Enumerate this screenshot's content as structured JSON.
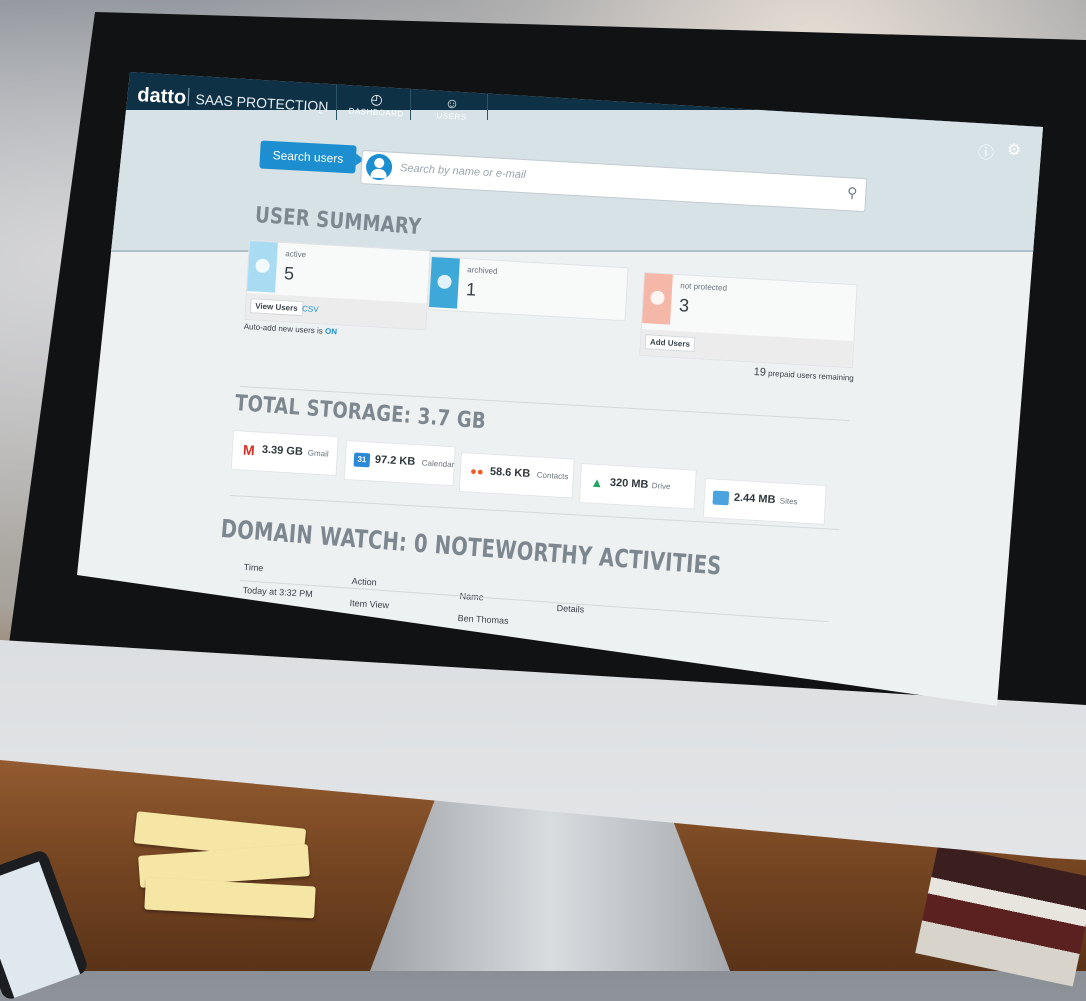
{
  "app": {
    "brand": "datto",
    "product": "SAAS PROTECTION",
    "nav": [
      {
        "label": "DASHBOARD",
        "icon": "dashboard-gauge-icon"
      },
      {
        "label": "USERS",
        "icon": "user-icon"
      }
    ],
    "top_icons": [
      "alert-icon",
      "gear-icon"
    ]
  },
  "search": {
    "button_label": "Search users",
    "placeholder": "Search by name or e-mail"
  },
  "user_summary": {
    "title": "USER SUMMARY",
    "cards": [
      {
        "status": "active",
        "count": "5",
        "color": "#a9dcf3"
      },
      {
        "status": "archived",
        "count": "1",
        "color": "#3ea8d8"
      },
      {
        "status": "not protected",
        "count": "3",
        "color": "#f5b7a8"
      }
    ],
    "view_users": "View Users",
    "csv": "CSV",
    "auto_add_prefix": "Auto-add new users is",
    "auto_add_state": "ON",
    "add_users": "Add Users",
    "prepaid_count": "19",
    "prepaid_text": "prepaid users remaining"
  },
  "storage": {
    "title": "TOTAL STORAGE: 3.7 GB",
    "items": [
      {
        "value": "3.39 GB",
        "name": "Gmail",
        "icon": "gmail-icon",
        "color": "#d93025"
      },
      {
        "value": "97.2 KB",
        "name": "Calendar",
        "icon": "calendar-icon",
        "color": "#2b8ad8",
        "glyph": "31"
      },
      {
        "value": "58.6 KB",
        "name": "Contacts",
        "icon": "contacts-icon",
        "color": "#f05a24"
      },
      {
        "value": "320 MB",
        "name": "Drive",
        "icon": "drive-icon",
        "color": "#1fa463"
      },
      {
        "value": "2.44 MB",
        "name": "Sites",
        "icon": "sites-icon",
        "color": "#4aa3df"
      }
    ]
  },
  "domain_watch": {
    "title": "DOMAIN WATCH: 0 NOTEWORTHY ACTIVITIES",
    "columns": [
      "Time",
      "Action",
      "Name",
      "Details"
    ],
    "rows": [
      {
        "time": "Today at 3:32 PM",
        "action": "Item View",
        "name": "Ben Thomas",
        "details": ""
      }
    ]
  }
}
